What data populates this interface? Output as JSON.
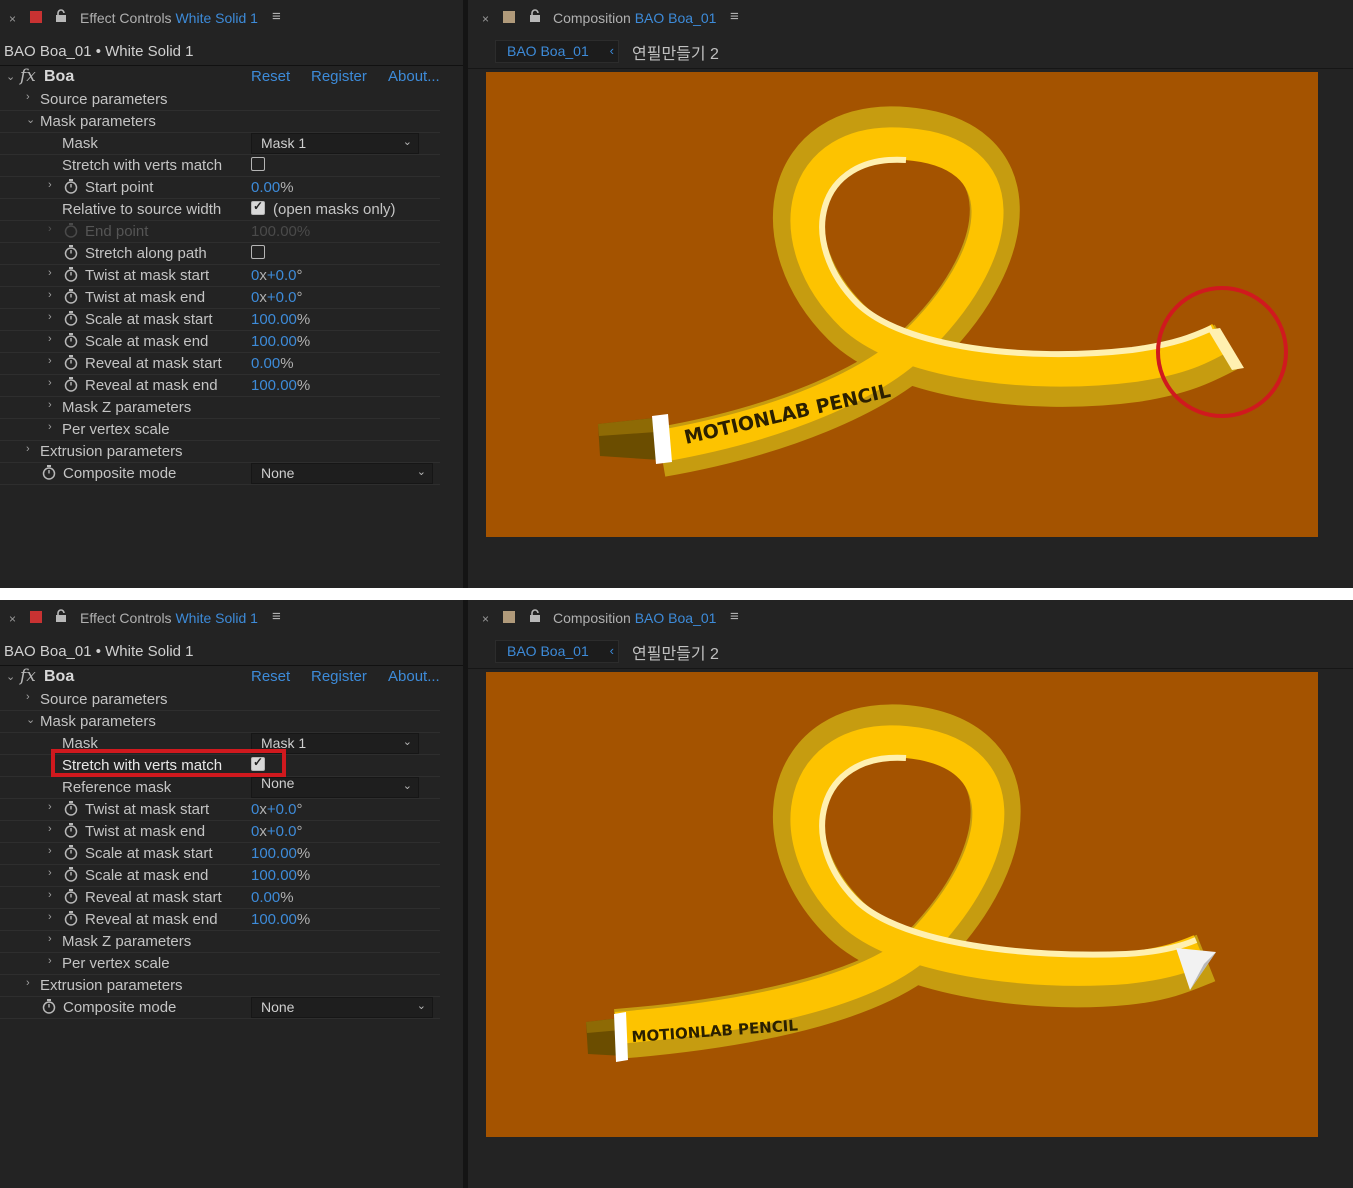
{
  "panels": [
    {
      "effect_tab": {
        "prefix": "Effect Controls",
        "layer": "White Solid 1"
      },
      "layer_path": "BAO Boa_01 • White Solid 1",
      "effect_name": "Boa",
      "links": {
        "reset": "Reset",
        "register": "Register",
        "about": "About..."
      },
      "rows": {
        "source": "Source parameters",
        "mask_params": "Mask parameters",
        "mask_label": "Mask",
        "mask_value": "Mask 1",
        "stretch": "Stretch with verts match",
        "start_label": "Start point",
        "start_value": "0.00",
        "start_unit": "%",
        "relative_label": "Relative to source width",
        "relative_note": "(open masks only)",
        "end_label": "End point",
        "end_value": "100.00%",
        "stretch_path": "Stretch along path",
        "twist_start": "Twist at mask start",
        "twist_start_a": "0",
        "twist_start_x": "x",
        "twist_start_b": "+0.0",
        "twist_start_deg": "°",
        "twist_end": "Twist at mask end",
        "twist_end_a": "0",
        "twist_end_x": "x",
        "twist_end_b": "+0.0",
        "twist_end_deg": "°",
        "scale_start": "Scale at mask start",
        "scale_start_v": "100.00",
        "scale_start_u": "%",
        "scale_end": "Scale at mask end",
        "scale_end_v": "100.00",
        "scale_end_u": "%",
        "reveal_start": "Reveal at mask start",
        "reveal_start_v": "0.00",
        "reveal_start_u": "%",
        "reveal_end": "Reveal at mask end",
        "reveal_end_v": "100.00",
        "reveal_end_u": "%",
        "mask_z": "Mask Z parameters",
        "per_vertex": "Per vertex scale",
        "extrusion": "Extrusion parameters",
        "composite": "Composite mode",
        "composite_value": "None"
      },
      "checkboxes": {
        "stretch_verts": false,
        "relative_width": true,
        "stretch_path": false
      },
      "comp_tab": {
        "prefix": "Composition",
        "name": "BAO Boa_01"
      },
      "comp_crumb_tab": "BAO Boa_01",
      "comp_crumb": "연필만들기 2",
      "pencil_label": "MOTIONLAB PENCIL"
    },
    {
      "effect_tab": {
        "prefix": "Effect Controls",
        "layer": "White Solid 1"
      },
      "layer_path": "BAO Boa_01 • White Solid 1",
      "effect_name": "Boa",
      "links": {
        "reset": "Reset",
        "register": "Register",
        "about": "About..."
      },
      "rows": {
        "source": "Source parameters",
        "mask_params": "Mask parameters",
        "mask_label": "Mask",
        "mask_value": "Mask 1",
        "stretch": "Stretch with verts match",
        "reference_label": "Reference mask",
        "reference_value": "None",
        "twist_start": "Twist at mask start",
        "twist_start_a": "0",
        "twist_start_x": "x",
        "twist_start_b": "+0.0",
        "twist_start_deg": "°",
        "twist_end": "Twist at mask end",
        "twist_end_a": "0",
        "twist_end_x": "x",
        "twist_end_b": "+0.0",
        "twist_end_deg": "°",
        "scale_start": "Scale at mask start",
        "scale_start_v": "100.00",
        "scale_start_u": "%",
        "scale_end": "Scale at mask end",
        "scale_end_v": "100.00",
        "scale_end_u": "%",
        "reveal_start": "Reveal at mask start",
        "reveal_start_v": "0.00",
        "reveal_start_u": "%",
        "reveal_end": "Reveal at mask end",
        "reveal_end_v": "100.00",
        "reveal_end_u": "%",
        "mask_z": "Mask Z parameters",
        "per_vertex": "Per vertex scale",
        "extrusion": "Extrusion parameters",
        "composite": "Composite mode",
        "composite_value": "None"
      },
      "checkboxes": {
        "stretch_verts": true
      },
      "comp_tab": {
        "prefix": "Composition",
        "name": "BAO Boa_01"
      },
      "comp_crumb_tab": "BAO Boa_01",
      "comp_crumb": "연필만들기 2",
      "pencil_label": "MOTIONLAB PENCIL"
    }
  ],
  "icons": {
    "close": "close-icon",
    "effect_swatch": "red-swatch",
    "comp_swatch": "tan-swatch",
    "lock": "lock-icon",
    "menu": "hamburger-menu-icon",
    "stopwatch": "stopwatch-icon",
    "twirl": "twirl-arrow-icon",
    "dropdown": "chevron-down-icon"
  },
  "colors": {
    "panel_bg": "#232323",
    "accent_blue": "#3d8bd9",
    "comp_bg": "#a45300",
    "pencil_yellow": "#fdc300",
    "pencil_shadow": "#c69c10",
    "highlight_red": "#d0191e",
    "effect_swatch": "#c83232",
    "comp_swatch": "#b09a7a"
  }
}
